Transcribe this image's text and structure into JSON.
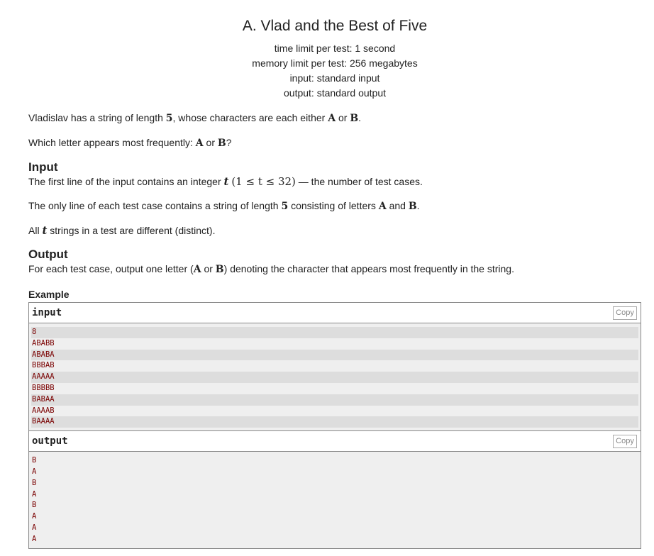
{
  "problem": {
    "title": "A. Vlad and the Best of Five",
    "limits": [
      "time limit per test: 1 second",
      "memory limit per test: 256 megabytes",
      "input: standard input",
      "output: standard output"
    ]
  },
  "statement": {
    "p1_a": "Vladislav has a string of length ",
    "p1_n": "5",
    "p1_b": ", whose characters are each either ",
    "p1_A": "A",
    "p1_or": " or ",
    "p1_B": "B",
    "p1_end": ".",
    "p2_a": "Which letter appears most frequently: ",
    "p2_A": "A",
    "p2_or": " or ",
    "p2_B": "B",
    "p2_end": "?"
  },
  "input_section": {
    "title": "Input",
    "p1_a": "The first line of the input contains an integer ",
    "p1_t": "t",
    "p1_range": "(1 ≤ t ≤ 32)",
    "p1_b": " — the number of test cases.",
    "p2_a": "The only line of each test case contains a string of length ",
    "p2_n": "5",
    "p2_b": " consisting of letters ",
    "p2_A": "A",
    "p2_and": " and ",
    "p2_B": "B",
    "p2_end": ".",
    "p3_a": "All ",
    "p3_t": "t",
    "p3_b": " strings in a test are different (distinct)."
  },
  "output_section": {
    "title": "Output",
    "p1_a": "For each test case, output one letter (",
    "p1_A": "A",
    "p1_or": " or ",
    "p1_B": "B",
    "p1_b": ") denoting the character that appears most frequently in the string."
  },
  "example": {
    "title": "Example",
    "input_label": "input",
    "output_label": "output",
    "copy_label": "Copy",
    "input_lines": [
      "8",
      "ABABB",
      "ABABA",
      "BBBAB",
      "AAAAA",
      "BBBBB",
      "BABAA",
      "AAAAB",
      "BAAAA"
    ],
    "output_lines": [
      "B",
      "A",
      "B",
      "A",
      "B",
      "A",
      "A",
      "A"
    ]
  }
}
